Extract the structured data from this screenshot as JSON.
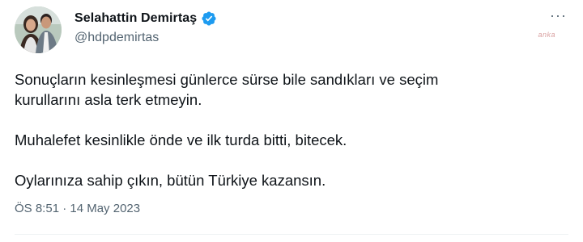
{
  "author": {
    "display_name": "Selahattin Demirtaş",
    "handle": "@hdpdemirtas",
    "verified_icon": "verified-badge-icon",
    "verified_color": "#1d9bf0"
  },
  "more_button_label": "···",
  "watermark": "anka",
  "tweet": {
    "lines": [
      "Sonuçların kesinleşmesi günlerce sürse bile sandıkları ve seçim",
      "kurullarını asla terk etmeyin.",
      "Muhalefet kesinlikle önde ve ilk turda bitti, bitecek.",
      "Oylarınıza sahip çıkın, bütün Türkiye kazansın."
    ]
  },
  "timestamp": "ÖS 8:51 · 14 May 2023",
  "colors": {
    "text": "#0f1419",
    "secondary": "#536471",
    "divider": "#eff3f4"
  }
}
